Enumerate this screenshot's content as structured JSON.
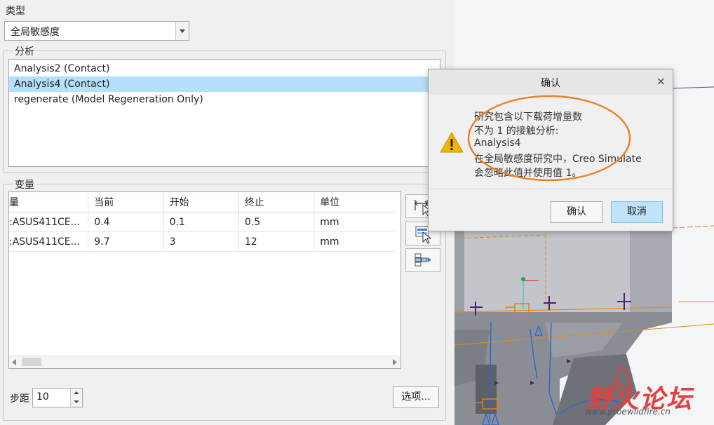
{
  "type_section": {
    "label": "类型",
    "selected": "全局敏感度"
  },
  "analysis_section": {
    "label": "分析",
    "items": [
      {
        "label": "Analysis2 (Contact)",
        "selected": false
      },
      {
        "label": "Analysis4 (Contact)",
        "selected": true
      },
      {
        "label": "regenerate (Model Regeneration Only)",
        "selected": false
      }
    ]
  },
  "variables_section": {
    "label": "变量",
    "columns": [
      "量",
      "当前",
      "开始",
      "终止",
      "单位"
    ],
    "rows": [
      [
        ":ASUS411CE...",
        "0.4",
        "0.1",
        "0.5",
        "mm"
      ],
      [
        ":ASUS411CE...",
        "9.7",
        "3",
        "12",
        "mm"
      ]
    ]
  },
  "steps": {
    "label": "步距",
    "value": "10"
  },
  "options_button": "选项...",
  "dialog": {
    "title": "确认",
    "close": "×",
    "message_lines": [
      "研究包含以下载荷增量数",
      "不为 1 的接触分析:",
      "Analysis4",
      "在全局敏感度研究中，Creo Simulate",
      "会忽略此值并使用值 1。"
    ],
    "confirm_label": "确认",
    "cancel_label": "取消"
  },
  "watermark": {
    "brand": "野火论坛",
    "url": "www.proewildfire.cn"
  },
  "colors": {
    "selection": "#b5e0fc",
    "highlight_circle": "#e8822c",
    "warning": "#f0b400",
    "cancel_button": "#bfe3fa",
    "watermark_red": "#e04040"
  }
}
